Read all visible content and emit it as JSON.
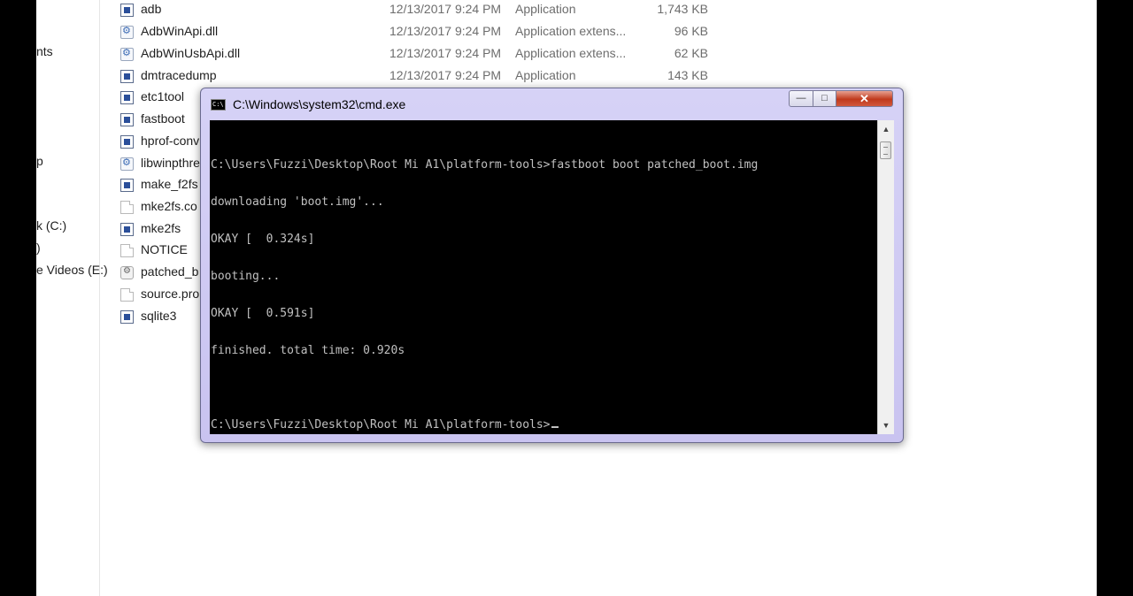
{
  "nav_pane": {
    "items": [
      {
        "label": "nts"
      },
      {
        "label": "p"
      },
      {
        "label": "k (C:)"
      },
      {
        "label": ")"
      },
      {
        "label": "e Videos (E:)"
      }
    ]
  },
  "files": [
    {
      "name": "adb",
      "date": "12/13/2017 9:24 PM",
      "type": "Application",
      "size": "1,743 KB",
      "icon": "app-icon"
    },
    {
      "name": "AdbWinApi.dll",
      "date": "12/13/2017 9:24 PM",
      "type": "Application extens...",
      "size": "96 KB",
      "icon": "dll-icon"
    },
    {
      "name": "AdbWinUsbApi.dll",
      "date": "12/13/2017 9:24 PM",
      "type": "Application extens...",
      "size": "62 KB",
      "icon": "dll-icon"
    },
    {
      "name": "dmtracedump",
      "date": "12/13/2017 9:24 PM",
      "type": "Application",
      "size": "143 KB",
      "icon": "app-icon"
    },
    {
      "name": "etc1tool",
      "date": "",
      "type": "",
      "size": "",
      "icon": "app-icon"
    },
    {
      "name": "fastboot",
      "date": "",
      "type": "",
      "size": "",
      "icon": "app-icon"
    },
    {
      "name": "hprof-conv",
      "date": "",
      "type": "",
      "size": "",
      "icon": "app-icon"
    },
    {
      "name": "libwinpthre",
      "date": "",
      "type": "",
      "size": "",
      "icon": "dll-icon"
    },
    {
      "name": "make_f2fs",
      "date": "",
      "type": "",
      "size": "",
      "icon": "app-icon"
    },
    {
      "name": "mke2fs.co",
      "date": "",
      "type": "",
      "size": "",
      "icon": "file-icon"
    },
    {
      "name": "mke2fs",
      "date": "",
      "type": "",
      "size": "",
      "icon": "app-icon"
    },
    {
      "name": "NOTICE",
      "date": "",
      "type": "",
      "size": "",
      "icon": "file-icon"
    },
    {
      "name": "patched_b",
      "date": "",
      "type": "",
      "size": "",
      "icon": "image-file-icon"
    },
    {
      "name": "source.pro",
      "date": "",
      "type": "",
      "size": "",
      "icon": "file-icon"
    },
    {
      "name": "sqlite3",
      "date": "",
      "type": "",
      "size": "",
      "icon": "app-icon"
    }
  ],
  "cmd_window": {
    "title": "C:\\Windows\\system32\\cmd.exe",
    "icon_text": "C:\\",
    "minimize_glyph": "—",
    "maximize_glyph": "□",
    "close_glyph": "✕",
    "scroll_up_glyph": "▲",
    "scroll_down_glyph": "▼",
    "lines": [
      "C:\\Users\\Fuzzi\\Desktop\\Root Mi A1\\platform-tools>fastboot boot patched_boot.img",
      "downloading 'boot.img'...",
      "OKAY [  0.324s]",
      "booting...",
      "OKAY [  0.591s]",
      "finished. total time: 0.920s",
      "",
      "C:\\Users\\Fuzzi\\Desktop\\Root Mi A1\\platform-tools>"
    ]
  }
}
